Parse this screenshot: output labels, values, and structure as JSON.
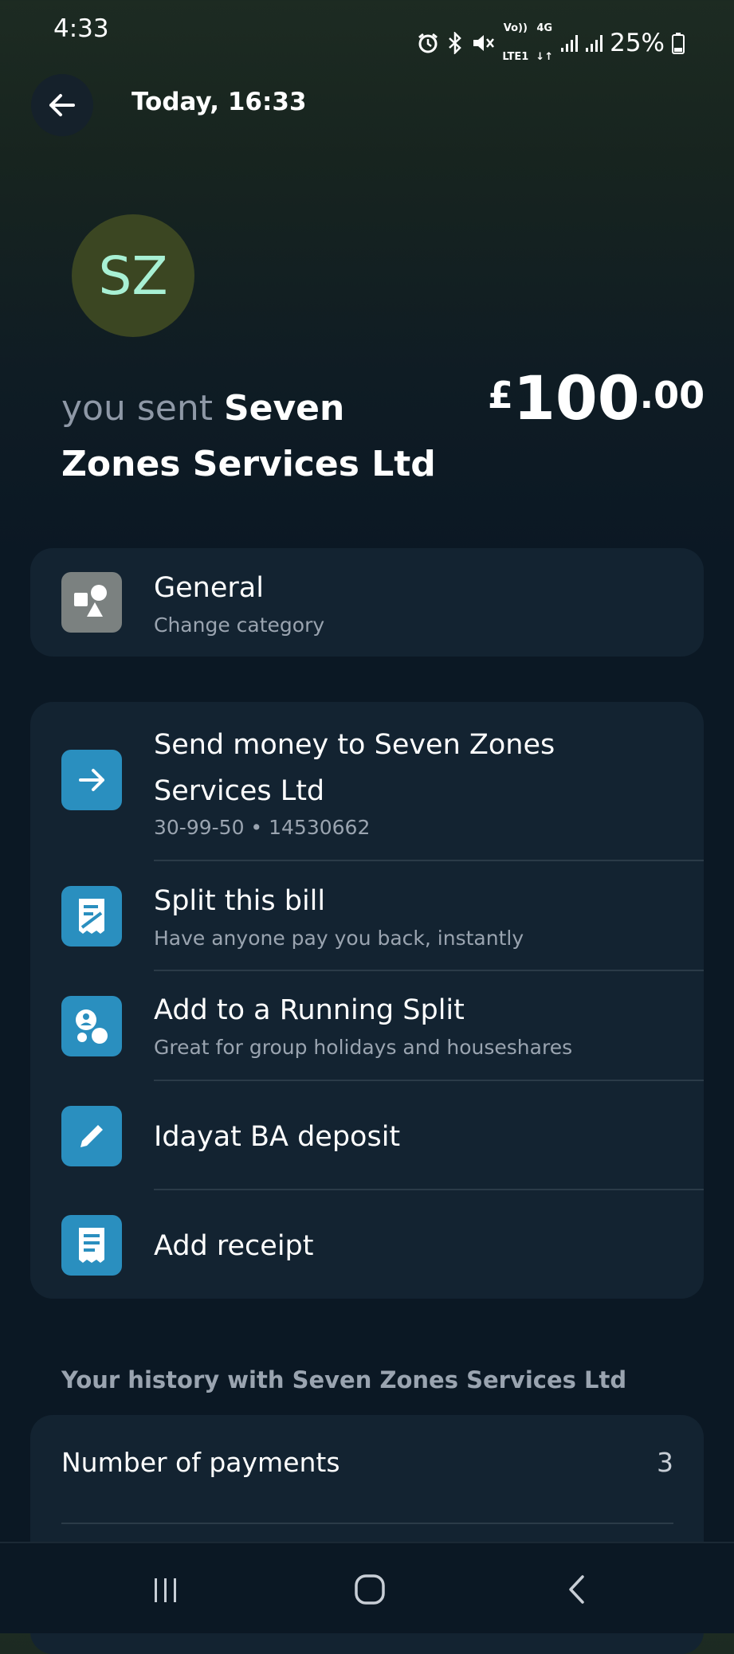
{
  "status_bar": {
    "time": "4:33",
    "battery": "25%",
    "lte_top": "Vo))",
    "lte_bottom": "LTE1",
    "network": "4G",
    "icons": [
      "alarm-icon",
      "bluetooth-icon",
      "mute-icon",
      "volte-icon",
      "4g-icon",
      "signal-icon",
      "signal-icon",
      "battery-icon"
    ]
  },
  "header": {
    "title": "Today, 16:33",
    "back_icon": "arrow-left-icon"
  },
  "transaction": {
    "initials": "SZ",
    "prefix": "you sent ",
    "payee": "Seven Zones Services Ltd",
    "currency": "£",
    "amount_major": "100",
    "amount_minor": ".00"
  },
  "category": {
    "title": "General",
    "subtitle": "Change category",
    "icon": "shapes-icon"
  },
  "actions": [
    {
      "title": "Send money to Seven Zones Services Ltd",
      "subtitle": "30-99-50 • 14530662",
      "icon": "arrow-right-icon"
    },
    {
      "title": "Split this bill",
      "subtitle": "Have anyone pay you back, instantly",
      "icon": "split-bill-icon"
    },
    {
      "title": "Add to a Running Split",
      "subtitle": "Great for group holidays and houseshares",
      "icon": "running-split-icon"
    },
    {
      "title": "Idayat BA deposit",
      "subtitle": "",
      "icon": "pencil-icon"
    },
    {
      "title": "Add receipt",
      "subtitle": "",
      "icon": "receipt-icon"
    }
  ],
  "history": {
    "header": "Your history with Seven Zones Services Ltd",
    "rows": [
      {
        "label": "Number of payments",
        "value": "3"
      }
    ]
  },
  "nav": {
    "icons": [
      "recent-apps-icon",
      "home-icon",
      "back-icon"
    ]
  },
  "colors": {
    "accent_blue": "#2a8fbf",
    "avatar_bg": "#3b4622",
    "avatar_text": "#a8f0d4",
    "card_bg": "#132331"
  }
}
